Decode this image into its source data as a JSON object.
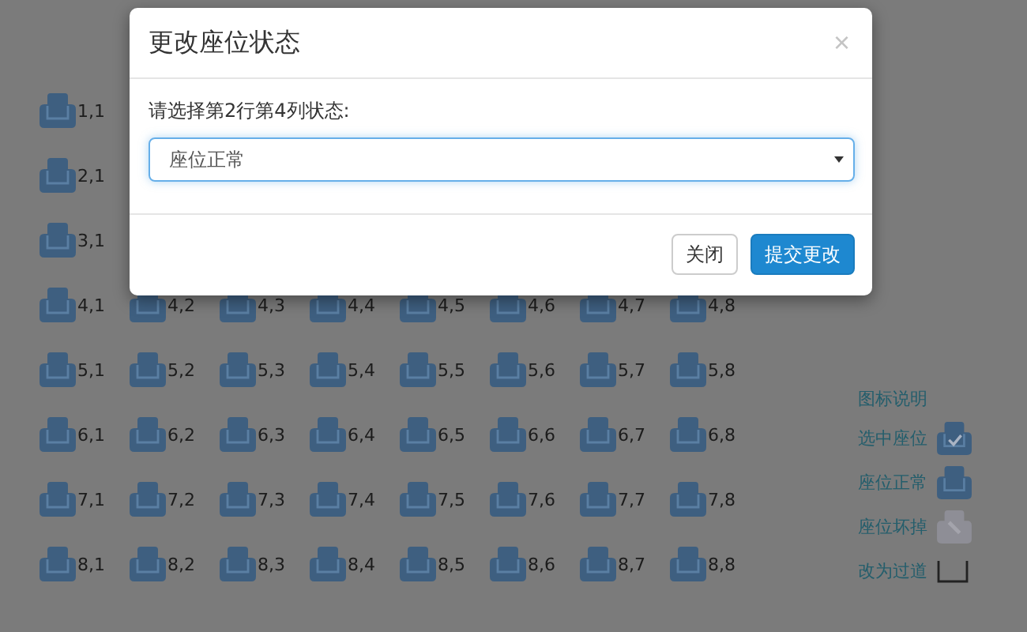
{
  "seat_rows": [
    {
      "seats": [
        {
          "label": "1,1",
          "kind": "normal"
        }
      ]
    },
    {
      "seats": [
        {
          "label": "2,1",
          "kind": "normal"
        }
      ]
    },
    {
      "seats": [
        {
          "label": "3,1",
          "kind": "normal"
        }
      ]
    },
    {
      "seats": [
        {
          "label": "4,1",
          "kind": "normal"
        },
        {
          "label": "4,2",
          "kind": "normal"
        },
        {
          "label": "4,3",
          "kind": "normal"
        },
        {
          "label": "4,4",
          "kind": "normal"
        },
        {
          "label": "4,5",
          "kind": "normal"
        },
        {
          "label": "4,6",
          "kind": "normal"
        },
        {
          "label": "4,7",
          "kind": "normal"
        },
        {
          "label": "4,8",
          "kind": "normal"
        }
      ]
    },
    {
      "seats": [
        {
          "label": "5,1",
          "kind": "normal"
        },
        {
          "label": "5,2",
          "kind": "normal"
        },
        {
          "label": "5,3",
          "kind": "normal"
        },
        {
          "label": "5,4",
          "kind": "normal"
        },
        {
          "label": "5,5",
          "kind": "normal"
        },
        {
          "label": "5,6",
          "kind": "normal"
        },
        {
          "label": "5,7",
          "kind": "normal"
        },
        {
          "label": "5,8",
          "kind": "normal"
        }
      ]
    },
    {
      "seats": [
        {
          "label": "6,1",
          "kind": "normal"
        },
        {
          "label": "6,2",
          "kind": "normal"
        },
        {
          "label": "6,3",
          "kind": "normal"
        },
        {
          "label": "6,4",
          "kind": "normal"
        },
        {
          "label": "6,5",
          "kind": "normal"
        },
        {
          "label": "6,6",
          "kind": "normal"
        },
        {
          "label": "6,7",
          "kind": "normal"
        },
        {
          "label": "6,8",
          "kind": "normal"
        }
      ]
    },
    {
      "seats": [
        {
          "label": "7,1",
          "kind": "normal"
        },
        {
          "label": "7,2",
          "kind": "normal"
        },
        {
          "label": "7,3",
          "kind": "normal"
        },
        {
          "label": "7,4",
          "kind": "normal"
        },
        {
          "label": "7,5",
          "kind": "normal"
        },
        {
          "label": "7,6",
          "kind": "normal"
        },
        {
          "label": "7,7",
          "kind": "normal"
        },
        {
          "label": "7,8",
          "kind": "normal"
        }
      ]
    },
    {
      "seats": [
        {
          "label": "8,1",
          "kind": "normal"
        },
        {
          "label": "8,2",
          "kind": "normal"
        },
        {
          "label": "8,3",
          "kind": "normal"
        },
        {
          "label": "8,4",
          "kind": "normal"
        },
        {
          "label": "8,5",
          "kind": "normal"
        },
        {
          "label": "8,6",
          "kind": "normal"
        },
        {
          "label": "8,7",
          "kind": "normal"
        },
        {
          "label": "8,8",
          "kind": "normal"
        }
      ]
    }
  ],
  "legend": {
    "title": "图标说明",
    "items": [
      {
        "label": "选中座位",
        "kind": "selected"
      },
      {
        "label": "座位正常",
        "kind": "normal"
      },
      {
        "label": "座位坏掉",
        "kind": "broken"
      },
      {
        "label": "改为过道",
        "kind": "aisle"
      }
    ]
  },
  "modal": {
    "title": "更改座位状态",
    "close": "×",
    "prompt": "请选择第2行第4列状态:",
    "select_value": "座位正常",
    "buttons": [
      {
        "label": "关闭",
        "kind": "default"
      },
      {
        "label": "提交更改",
        "kind": "primary"
      }
    ]
  }
}
